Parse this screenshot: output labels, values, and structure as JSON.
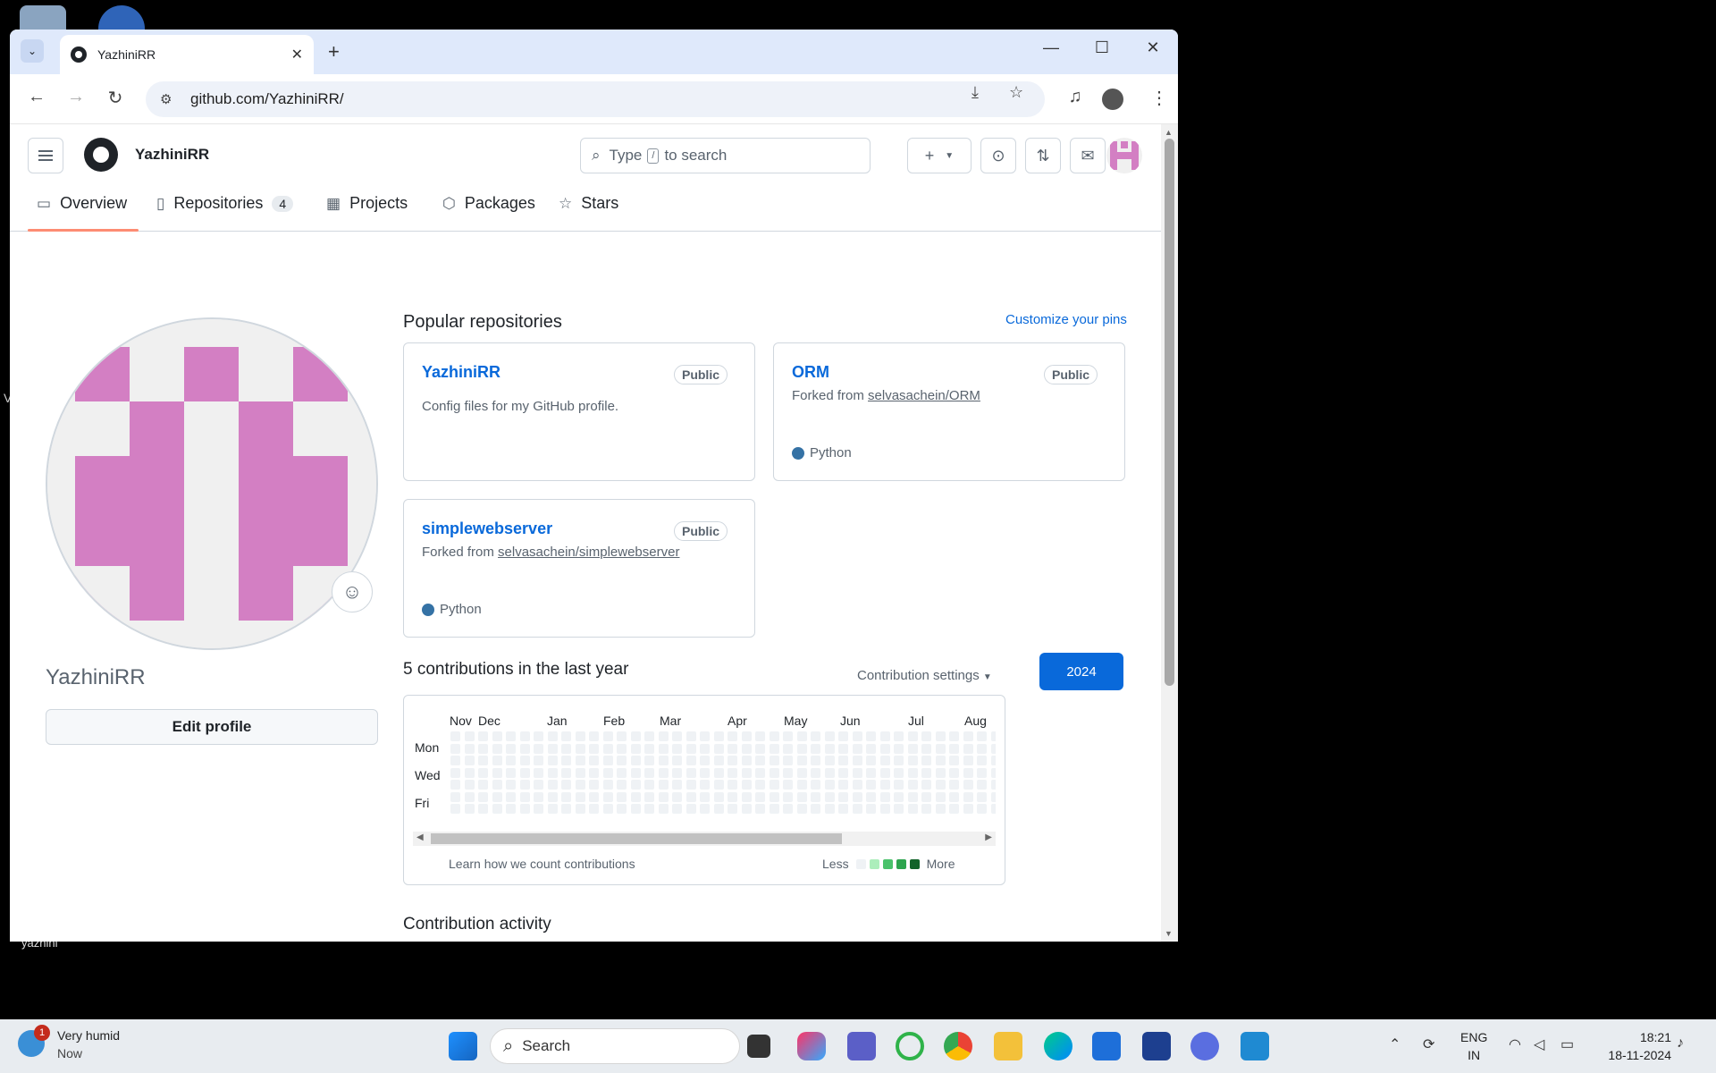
{
  "desktop": {
    "icon_label": "yazhini",
    "edge_char": "V"
  },
  "browser": {
    "tab_title": "YazhiniRR",
    "url": "github.com/YazhiniRR/",
    "win_controls": {
      "minimize": "—",
      "maximize": "☐",
      "close": "✕"
    }
  },
  "github": {
    "username": "YazhiniRR",
    "search_placeholder_pre": "Type",
    "search_key": "/",
    "search_placeholder_post": "to search",
    "nav": [
      {
        "label": "Overview",
        "icon": "book-icon"
      },
      {
        "label": "Repositories",
        "icon": "repo-icon",
        "count": "4"
      },
      {
        "label": "Projects",
        "icon": "table-icon"
      },
      {
        "label": "Packages",
        "icon": "package-icon"
      },
      {
        "label": "Stars",
        "icon": "star-icon"
      }
    ],
    "profile": {
      "name": "YazhiniRR",
      "edit_label": "Edit profile"
    },
    "popular": {
      "title": "Popular repositories",
      "customize": "Customize your pins",
      "repos": [
        {
          "name": "YazhiniRR",
          "badge": "Public",
          "desc": "Config files for my GitHub profile.",
          "fork_prefix": "",
          "fork_link": "",
          "language": ""
        },
        {
          "name": "ORM",
          "badge": "Public",
          "desc": "",
          "fork_prefix": "Forked from ",
          "fork_link": "selvasachein/ORM",
          "language": "Python"
        },
        {
          "name": "simplewebserver",
          "badge": "Public",
          "desc": "",
          "fork_prefix": "Forked from ",
          "fork_link": "selvasachein/simplewebserver",
          "language": "Python"
        }
      ],
      "lang_color": "#3572A5"
    },
    "contributions": {
      "title": "5 contributions in the last year",
      "settings": "Contribution settings",
      "year": "2024",
      "months": [
        "Nov",
        "Dec",
        "Jan",
        "Feb",
        "Mar",
        "Apr",
        "May",
        "Jun",
        "Jul",
        "Aug"
      ],
      "days": [
        "Mon",
        "Wed",
        "Fri"
      ],
      "learn": "Learn how we count contributions",
      "less": "Less",
      "more": "More",
      "legend_colors": [
        "#eff2f5",
        "#aceebb",
        "#4ac26b",
        "#2da44e",
        "#116329"
      ]
    },
    "activity_title": "Contribution activity"
  },
  "taskbar": {
    "weather_main": "Very humid",
    "weather_sub": "Now",
    "notification_count": "1",
    "search_label": "Search",
    "lang_top": "ENG",
    "lang_bottom": "IN",
    "time": "18:21",
    "date": "18-11-2024"
  }
}
